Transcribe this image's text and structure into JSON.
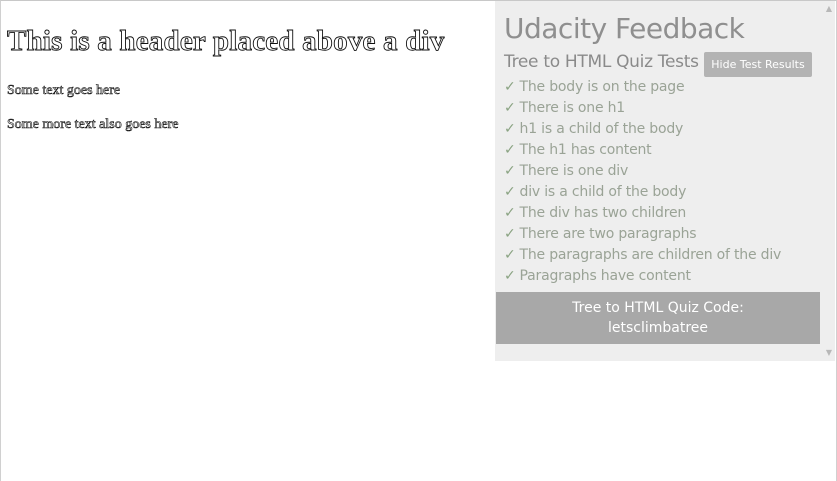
{
  "page": {
    "heading": "This is a header placed above a div",
    "paragraphs": [
      "Some text goes here",
      "Some more text also goes here"
    ]
  },
  "feedback": {
    "title": "Udacity Feedback",
    "subtitle": "Tree to HTML Quiz Tests",
    "hide_button": "Hide Test Results",
    "check_mark": "✓",
    "tests": [
      "The body is on the page",
      "There is one h1",
      "h1 is a child of the body",
      "The h1 has content",
      "There is one div",
      "div is a child of the body",
      "The div has two children",
      "There are two paragraphs",
      "The paragraphs are children of the div",
      "Paragraphs have content"
    ],
    "code_label": "Tree to HTML Quiz Code:",
    "code_value": "letsclimbatree"
  },
  "colors": {
    "panel_bg": "#eeeeee",
    "pass_text": "#9aa396",
    "button_bg": "#b3b3b3",
    "code_bg": "#a8a8a8"
  },
  "icons": {
    "scroll_up": "scroll-up-arrow-icon",
    "scroll_down": "scroll-down-arrow-icon",
    "check": "check-icon"
  }
}
